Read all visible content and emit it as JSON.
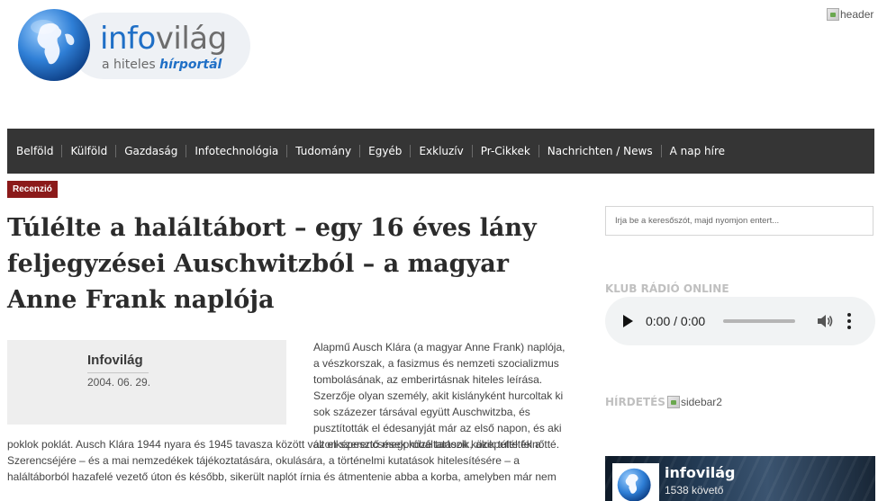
{
  "header": {
    "logo_name_part1": "info",
    "logo_name_part2": "világ",
    "tagline_prefix": "a hiteles ",
    "tagline_highlight": "hírportál",
    "header_image_alt": "header"
  },
  "nav": {
    "items": [
      "Belföld",
      "Külföld",
      "Gazdaság",
      "Infotechnológia",
      "Tudomány",
      "Egyéb",
      "Exkluzív",
      "Pr-Cikkek",
      "Nachrichten / News",
      "A nap híre"
    ]
  },
  "article": {
    "category": "Recenzió",
    "title": "Túlélte a haláltábort – egy 16 éves lány feljegyzései Auschwitzból – a magyar Anne Frank naplója",
    "author": "Infovilág",
    "date": "2004. 06. 29.",
    "body_right_lines": [
      "Alapmű Ausch Klára (a magyar Anne Frank) naplója,",
      "a vészkorszak, a fasizmus és nemzeti szocializmus",
      "tombolásának, az emberirtásnak hiteles leírása.",
      "Szerzője olyan személy, akit kislányként hurcoltak ki",
      "sok százezer társával együtt Auschwitzba, és",
      "pusztították el édesanyját már az első napon, és aki",
      "azon szerencsések közé tartozik, akik túlélték a"
    ],
    "body_full_lines": [
      "poklok poklát. Ausch Klára 1944 nyara és 1945 tavasza között vált elképesztő megpróbáltatások közepette felnőtté.",
      "Szerencséjére – és a mai nemzedékek tájékoztatására, okulására, a történelmi kutatások hitelesítésére – a",
      "haláltáborból hazafelé vezető úton és később, sikerült naplót írnia és átmentenie abba a korba, amelyben már nem"
    ]
  },
  "sidebar": {
    "search_placeholder": "Irja be a keresőszót, majd nyomjon entert...",
    "radio_title": "KLUB RÁDIÓ ONLINE",
    "player_time": "0:00 / 0:00",
    "ads_label": "HÍRDETÉS",
    "ads_image_alt": "sidebar2",
    "fb_name": "infovilág",
    "fb_followers": "1538 követő"
  },
  "colors": {
    "nav_bg": "#353535",
    "badge_bg": "#8b1a1a",
    "brand_blue": "#1f6fc6",
    "sidebar_heading": "#c0c0c0"
  }
}
